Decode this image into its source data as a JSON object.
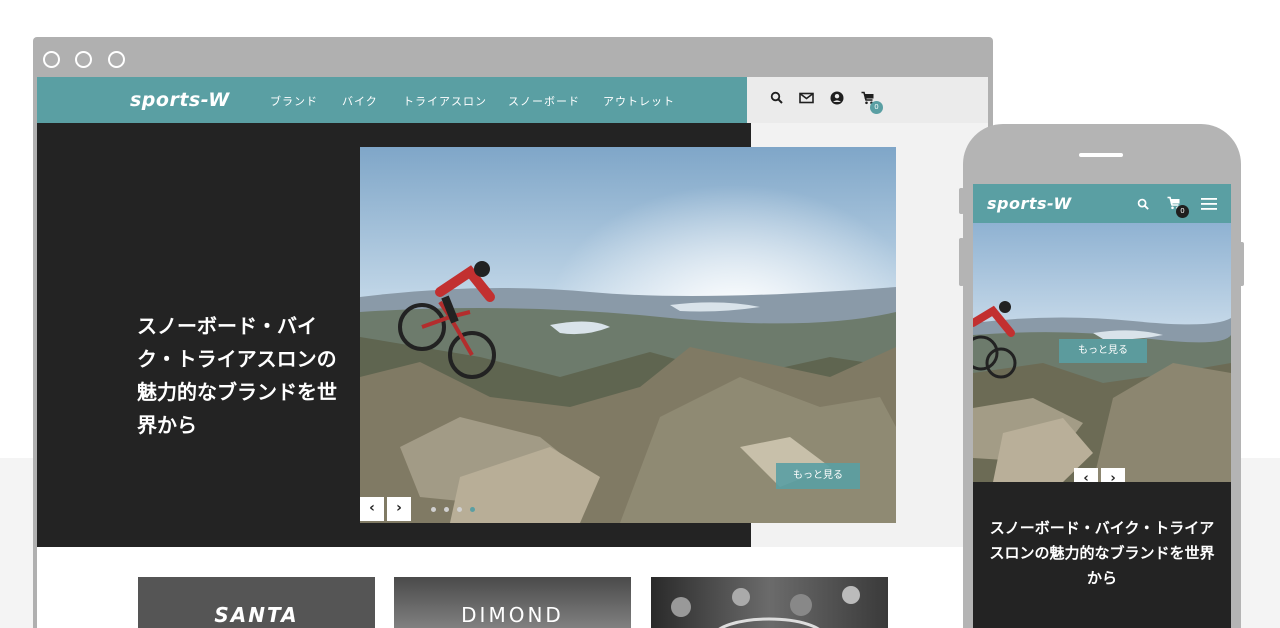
{
  "brand": {
    "logo_text": "sports-W"
  },
  "nav": {
    "links": [
      "ブランド",
      "バイク",
      "トライアスロン",
      "スノーボード",
      "アウトレット"
    ],
    "icons": [
      "search-icon",
      "mail-icon",
      "account-icon",
      "cart-icon"
    ],
    "cart_count": "0"
  },
  "hero": {
    "title": "スノーボード・バイク・トライアスロンの魅力的なブランドを世界から",
    "more_label": "もっと見る",
    "prev_label": "‹",
    "next_label": "›",
    "slide_count": 4,
    "active_slide": 4
  },
  "brands": [
    "SANTA",
    "DIMOND",
    ""
  ],
  "mobile": {
    "logo_text": "sports-W",
    "cart_count": "0",
    "more_label": "もっと見る",
    "prev_label": "‹",
    "next_label": "›",
    "title": "スノーボード・バイク・トライアスロンの魅力的なブランドを世界から"
  },
  "colors": {
    "accent": "#5a9fa3",
    "dark": "#232323",
    "light": "#f2f2f2"
  }
}
